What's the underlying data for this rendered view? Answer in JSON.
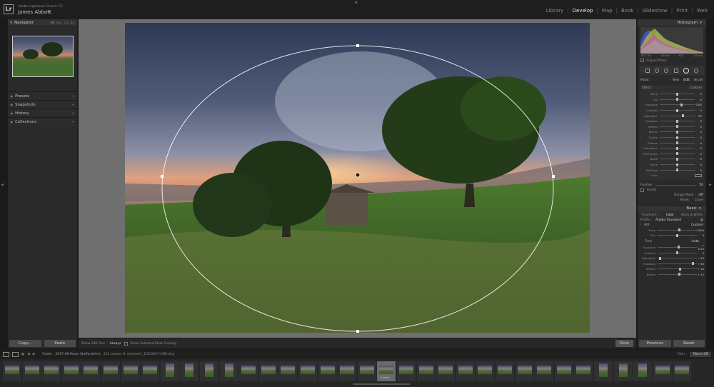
{
  "app": {
    "logo": "Lr",
    "product": "Adobe Lightroom Classic CC",
    "user": "James Abbott",
    "user_arrow": "▾"
  },
  "modules": [
    {
      "label": "Library",
      "active": false
    },
    {
      "label": "Develop",
      "active": true
    },
    {
      "label": "Map",
      "active": false
    },
    {
      "label": "Book",
      "active": false
    },
    {
      "label": "Slideshow",
      "active": false
    },
    {
      "label": "Print",
      "active": false
    },
    {
      "label": "Web",
      "active": false
    }
  ],
  "left_panel": {
    "navigator": {
      "title": "Navigator",
      "zoom_options": [
        "FIT",
        "FILL",
        "1:1",
        "3:1"
      ]
    },
    "sections": [
      {
        "label": "Presets"
      },
      {
        "label": "Snapshots"
      },
      {
        "label": "History"
      },
      {
        "label": "Collections"
      }
    ],
    "copy_label": "Copy...",
    "paste_label": "Paste"
  },
  "toolbar": {
    "show_edit_pins_label": "Show Edit Pins :",
    "show_edit_pins_value": "Always",
    "show_mask_overlay_label": "Show Selected Mask Overlay",
    "done_label": "Done"
  },
  "right_panel": {
    "histogram": {
      "title": "Histogram",
      "info": [
        "ISO 100",
        "16 mm",
        "f/11",
        "1/4 sec"
      ],
      "original_photo_label": "Original Photo"
    },
    "mask": {
      "label": "Mask :",
      "new_label": "New",
      "edit_label": "Edit",
      "brush_label": "Brush"
    },
    "effect": {
      "label": "Effect :",
      "value": "Custom",
      "sliders": [
        {
          "label": "Temp",
          "value": "0",
          "pos": 0.5
        },
        {
          "label": "Tint",
          "value": "0",
          "pos": 0.5
        },
        {
          "label": "Exposure",
          "value": "0.62",
          "pos": 0.62
        },
        {
          "label": "Contrast",
          "value": "0",
          "pos": 0.5
        },
        {
          "label": "Highlights",
          "value": "35",
          "pos": 0.67
        },
        {
          "label": "Shadows",
          "value": "0",
          "pos": 0.5
        },
        {
          "label": "Whites",
          "value": "0",
          "pos": 0.5
        },
        {
          "label": "Blacks",
          "value": "0",
          "pos": 0.5
        },
        {
          "label": "Clarity",
          "value": "0",
          "pos": 0.5
        },
        {
          "label": "Dehaze",
          "value": "0",
          "pos": 0.5
        },
        {
          "label": "Saturation",
          "value": "0",
          "pos": 0.5
        },
        {
          "label": "Sharpness",
          "value": "0",
          "pos": 0.5
        },
        {
          "label": "Noise",
          "value": "0",
          "pos": 0.5
        },
        {
          "label": "Moiré",
          "value": "0",
          "pos": 0.5
        },
        {
          "label": "Defringe",
          "value": "0",
          "pos": 0.5
        }
      ],
      "color_label": "Color"
    },
    "feather_label": "Feather",
    "feather_value": "50",
    "invert_label": "Invert",
    "range_mask_label": "Range Mask :",
    "range_mask_value": "Off",
    "reset_label": "Reset",
    "close_label": "Close",
    "basic": {
      "title": "Basic",
      "tabs": [
        "Treatment :",
        "Color",
        "Black & White"
      ],
      "profile_label": "Profile :",
      "profile_value": "Adobe Standard",
      "wb_label": "WB :",
      "wb_value": "Custom",
      "wb_sliders": [
        {
          "label": "Temp",
          "value": "5300",
          "pos": 0.55
        },
        {
          "label": "Tint",
          "value": "0",
          "pos": 0.5
        }
      ],
      "tone_label": "Tone",
      "auto_label": "Auto",
      "tone_sliders": [
        {
          "label": "Exposure",
          "value": "+ 0.25",
          "pos": 0.53
        },
        {
          "label": "Contrast",
          "value": "0",
          "pos": 0.5
        },
        {
          "label": "Highlights",
          "value": "− 90",
          "pos": 0.06
        },
        {
          "label": "Shadows",
          "value": "+ 80",
          "pos": 0.9
        },
        {
          "label": "Whites",
          "value": "+ 14",
          "pos": 0.57
        },
        {
          "label": "Blacks",
          "value": "+ 12",
          "pos": 0.56
        }
      ]
    },
    "previous_label": "Previous",
    "reset_button_label": "Reset"
  },
  "filmbar": {
    "path": "Folder : 2017-08 Peaks Staffordshire",
    "count": "221 photos /1 selected /_DSC0027-HDR.dng",
    "filter_label": "Filter :",
    "filter_value": "Filters Off"
  },
  "filmstrip": {
    "thumbs": [
      {
        "portrait": false,
        "stars": "",
        "active": false
      },
      {
        "portrait": false,
        "stars": "",
        "active": false
      },
      {
        "portrait": false,
        "stars": "",
        "active": false
      },
      {
        "portrait": false,
        "stars": "",
        "active": false
      },
      {
        "portrait": false,
        "stars": "",
        "active": false
      },
      {
        "portrait": false,
        "stars": "",
        "active": false
      },
      {
        "portrait": false,
        "stars": "",
        "active": false
      },
      {
        "portrait": false,
        "stars": "",
        "active": false
      },
      {
        "portrait": true,
        "stars": "",
        "active": false
      },
      {
        "portrait": true,
        "stars": "",
        "active": false
      },
      {
        "portrait": true,
        "stars": "",
        "active": false
      },
      {
        "portrait": true,
        "stars": "",
        "active": false
      },
      {
        "portrait": false,
        "stars": "",
        "active": false
      },
      {
        "portrait": false,
        "stars": "",
        "active": false
      },
      {
        "portrait": false,
        "stars": "",
        "active": false
      },
      {
        "portrait": false,
        "stars": "",
        "active": false
      },
      {
        "portrait": false,
        "stars": "",
        "active": false
      },
      {
        "portrait": false,
        "stars": "",
        "active": false
      },
      {
        "portrait": false,
        "stars": "",
        "active": false
      },
      {
        "portrait": false,
        "stars": "★★★★★",
        "active": true
      },
      {
        "portrait": false,
        "stars": "",
        "active": false
      },
      {
        "portrait": false,
        "stars": "",
        "active": false
      },
      {
        "portrait": false,
        "stars": "",
        "active": false
      },
      {
        "portrait": false,
        "stars": "",
        "active": false
      },
      {
        "portrait": false,
        "stars": "",
        "active": false
      },
      {
        "portrait": false,
        "stars": "",
        "active": false
      },
      {
        "portrait": false,
        "stars": "",
        "active": false
      },
      {
        "portrait": false,
        "stars": "",
        "active": false
      },
      {
        "portrait": false,
        "stars": "",
        "active": false
      },
      {
        "portrait": false,
        "stars": "",
        "active": false
      },
      {
        "portrait": true,
        "stars": "",
        "active": false
      },
      {
        "portrait": true,
        "stars": "",
        "active": false
      },
      {
        "portrait": true,
        "stars": "",
        "active": false
      },
      {
        "portrait": false,
        "stars": "",
        "active": false
      },
      {
        "portrait": false,
        "stars": "",
        "active": false
      }
    ]
  }
}
